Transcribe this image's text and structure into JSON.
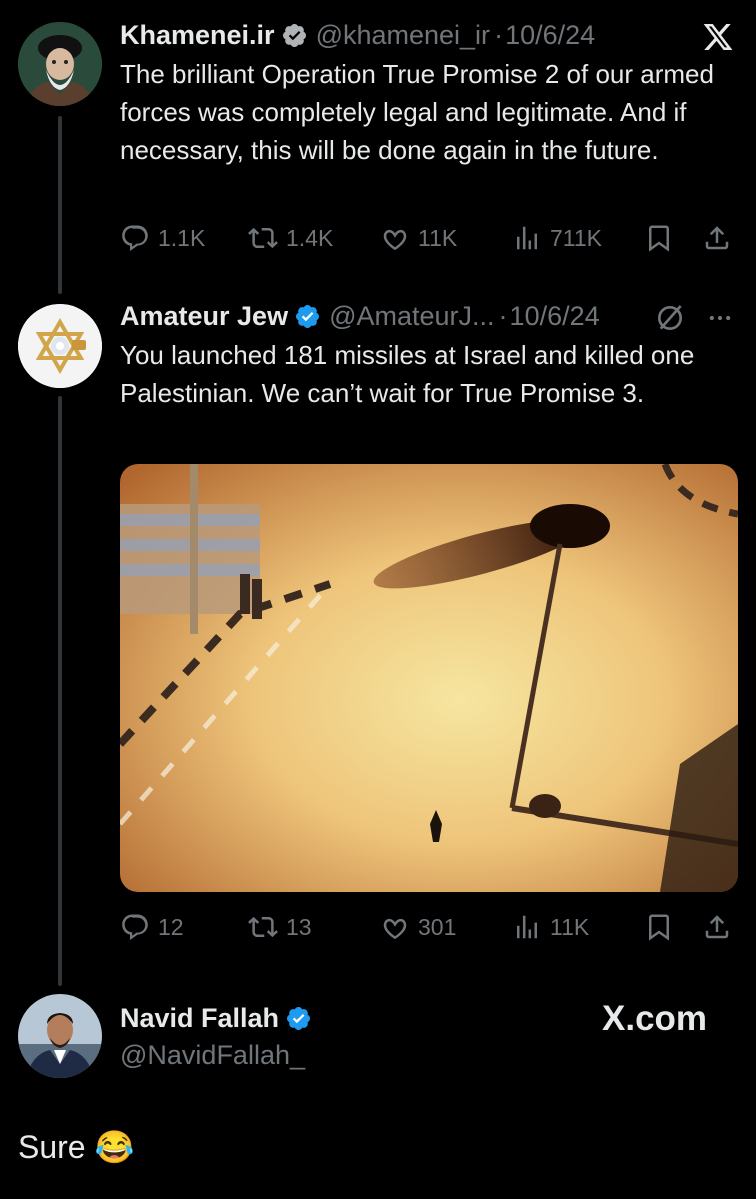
{
  "tweet1": {
    "name": "Khamenei.ir",
    "handle": "@khamenei_ir",
    "sep": "·",
    "date": "10/6/24",
    "text": "The brilliant Operation True Promise 2 of our armed forces was completely legal and legitimate. And if necessary, this will be done again in the future.",
    "replies": "1.1K",
    "reposts": "1.4K",
    "likes": "11K",
    "views": "711K"
  },
  "tweet2": {
    "name": "Amateur Jew",
    "handle": "@AmateurJ...",
    "sep": "·",
    "date": "10/6/24",
    "text": "You launched 181 missiles at Israel and killed one Palestinian. We can’t wait for True Promise 3.",
    "replies": "12",
    "reposts": "13",
    "likes": "301",
    "views": "11K"
  },
  "reply": {
    "name": "Navid Fallah",
    "handle": "@NavidFallah_",
    "text": "Sure 😂"
  },
  "watermark": "X.com",
  "colors": {
    "background": "#000000",
    "text": "#e7e9ea",
    "muted": "#71767b",
    "verified": "#1d9bf0"
  },
  "icons": [
    "x-logo-icon",
    "verified-badge-icon",
    "reply-icon",
    "repost-icon",
    "like-icon",
    "views-icon",
    "bookmark-icon",
    "share-icon",
    "grok-icon",
    "more-icon"
  ]
}
